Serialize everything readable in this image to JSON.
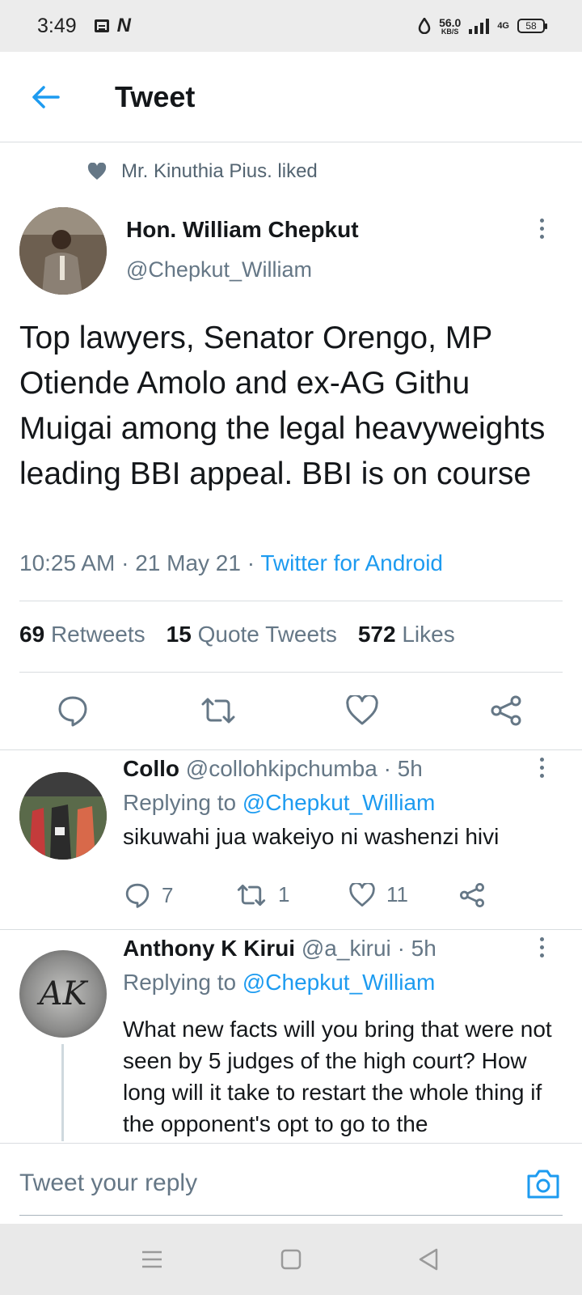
{
  "status_bar": {
    "time": "3:49",
    "speed_value": "56.0",
    "speed_unit": "KB/S",
    "network": "4G",
    "battery": "58"
  },
  "header": {
    "title": "Tweet"
  },
  "social_context": {
    "text": "Mr. Kinuthia Pius. liked"
  },
  "tweet": {
    "author_name": "Hon. William Chepkut",
    "author_handle": "@Chepkut_William",
    "text": "Top lawyers, Senator Orengo, MP Otiende Amolo and ex-AG Githu Muigai among the legal heavyweights leading BBI  appeal. BBI is on course",
    "time": "10:25 AM",
    "date": "21 May 21",
    "source": "Twitter for Android",
    "retweets": "69",
    "retweets_label": "Retweets",
    "quotes": "15",
    "quotes_label": "Quote Tweets",
    "likes": "572",
    "likes_label": "Likes"
  },
  "replies": [
    {
      "name": "Collo",
      "handle": "@collohkipchumba",
      "age": "5h",
      "replying_prefix": "Replying to",
      "replying_to": "@Chepkut_William",
      "text": "sikuwahi jua wakeiyo ni washenzi hivi",
      "replies": "7",
      "retweets": "1",
      "likes": "11"
    },
    {
      "name": "Anthony K Kirui",
      "handle": "@a_kirui",
      "age": "5h",
      "replying_prefix": "Replying to",
      "replying_to": "@Chepkut_William",
      "text": "What new facts will you bring that were not seen by 5 judges of the high court? How long will it take to restart the whole thing if the opponent's opt to go to the",
      "avatar_initials": "AK"
    }
  ],
  "compose": {
    "placeholder": "Tweet your reply"
  },
  "colors": {
    "accent": "#1d9bf0",
    "secondary_text": "#657786",
    "primary_text": "#14171a"
  }
}
